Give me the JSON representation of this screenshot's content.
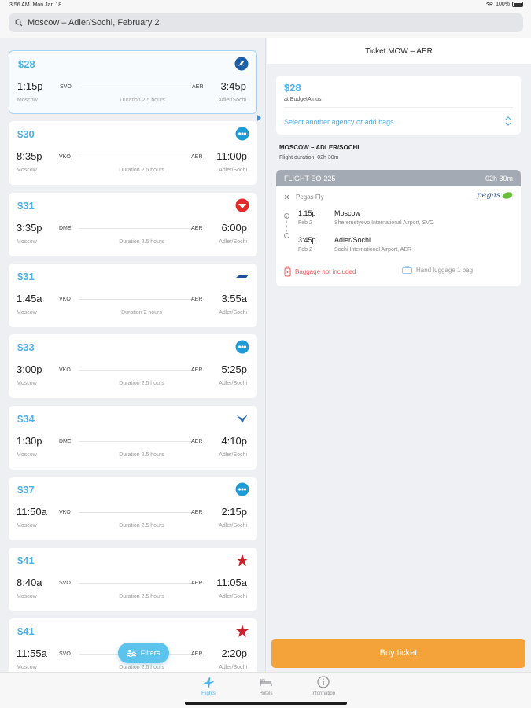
{
  "status_bar": {
    "time": "3:56 AM",
    "date": "Mon Jan 18",
    "battery": "100%"
  },
  "search": {
    "query": "Moscow – Adler/Sochi, February 2"
  },
  "flights": [
    {
      "price": "$28",
      "dep_time": "1:15p",
      "dep_code": "SVO",
      "arr_code": "AER",
      "arr_time": "3:45p",
      "dep_city": "Moscow",
      "duration": "Duration 2.5 hours",
      "arr_city": "Adler/Sochi",
      "airline_icon": "pegas-bird-logo",
      "logo_color": "#1f5fa5"
    },
    {
      "price": "$30",
      "dep_time": "8:35p",
      "dep_code": "VKO",
      "arr_code": "AER",
      "arr_time": "11:00p",
      "dep_city": "Moscow",
      "duration": "Duration 2.5 hours",
      "arr_city": "Adler/Sochi",
      "airline_icon": "dots-circle-logo",
      "logo_color": "#1e9ad6"
    },
    {
      "price": "$31",
      "dep_time": "3:35p",
      "dep_code": "DME",
      "arr_code": "AER",
      "arr_time": "6:00p",
      "dep_city": "Moscow",
      "duration": "Duration 2.5 hours",
      "arr_city": "Adler/Sochi",
      "airline_icon": "red-circle-logo",
      "logo_color": "#e22a2a"
    },
    {
      "price": "$31",
      "dep_time": "1:45a",
      "dep_code": "VKO",
      "arr_code": "AER",
      "arr_time": "3:55a",
      "dep_city": "Moscow",
      "duration": "Duration 2 hours",
      "arr_city": "Adler/Sochi",
      "airline_icon": "wordmark-logo",
      "logo_color": "#1d4fa0"
    },
    {
      "price": "$33",
      "dep_time": "3:00p",
      "dep_code": "VKO",
      "arr_code": "AER",
      "arr_time": "5:25p",
      "dep_city": "Moscow",
      "duration": "Duration 2.5 hours",
      "arr_city": "Adler/Sochi",
      "airline_icon": "dots-circle-logo",
      "logo_color": "#1e9ad6"
    },
    {
      "price": "$34",
      "dep_time": "1:30p",
      "dep_code": "DME",
      "arr_code": "AER",
      "arr_time": "4:10p",
      "dep_city": "Moscow",
      "duration": "Duration 2.5 hours",
      "arr_city": "Adler/Sochi",
      "airline_icon": "bird-logo",
      "logo_color": "#2c6db5"
    },
    {
      "price": "$37",
      "dep_time": "11:50a",
      "dep_code": "VKO",
      "arr_code": "AER",
      "arr_time": "2:15p",
      "dep_city": "Moscow",
      "duration": "Duration 2.5 hours",
      "arr_city": "Adler/Sochi",
      "airline_icon": "dots-circle-logo",
      "logo_color": "#1e9ad6"
    },
    {
      "price": "$41",
      "dep_time": "8:40a",
      "dep_code": "SVO",
      "arr_code": "AER",
      "arr_time": "11:05a",
      "dep_city": "Moscow",
      "duration": "Duration 2.5 hours",
      "arr_city": "Adler/Sochi",
      "airline_icon": "red-star-logo",
      "logo_color": "#c8202c"
    },
    {
      "price": "$41",
      "dep_time": "11:55a",
      "dep_code": "SVO",
      "arr_code": "AER",
      "arr_time": "2:20p",
      "dep_city": "Moscow",
      "duration": "Duration 2.5 hours",
      "arr_city": "Adler/Sochi",
      "airline_icon": "red-star-logo",
      "logo_color": "#c8202c"
    }
  ],
  "filters": {
    "label": "Filters"
  },
  "detail": {
    "header": "Ticket MOW – AER",
    "price": "$28",
    "agency": "at BudgetAir.us",
    "select_agency": "Select another agency or add bags",
    "route_title": "MOSCOW – ADLER/SOCHI",
    "route_duration": "Flight duration: 02h 30m",
    "flight": {
      "number": "FLIGHT EO-225",
      "duration": "02h 30m",
      "airline": "Pegas Fly",
      "logo_text": "pegas",
      "dep_time": "1:15p",
      "dep_date": "Feb 2",
      "dep_city": "Moscow",
      "dep_airport": "Sheremetyevo International Airport, SVO",
      "arr_time": "3:45p",
      "arr_date": "Feb 2",
      "arr_city": "Adler/Sochi",
      "arr_airport": "Sochi International Airport, AER",
      "baggage": "Baggage not included",
      "hand_luggage": "Hand luggage 1 bag"
    },
    "buy_label": "Buy ticket"
  },
  "tabs": [
    {
      "label": "Flights",
      "icon": "plane-icon",
      "active": true
    },
    {
      "label": "Hotels",
      "icon": "bed-icon",
      "active": false
    },
    {
      "label": "Information",
      "icon": "info-icon",
      "active": false
    }
  ],
  "colors": {
    "accent": "#4db1e8",
    "buy": "#f4a23a",
    "warning": "#ef5a5a"
  }
}
